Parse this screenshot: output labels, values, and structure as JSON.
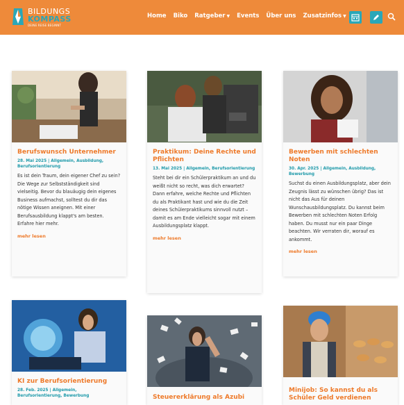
{
  "header": {
    "logo_line1": "BILDUNGS",
    "logo_line2": "KOMPASS",
    "logo_tagline": "DEINE REISE BEGINNT",
    "nav": [
      {
        "label": "Home",
        "dropdown": false
      },
      {
        "label": "Biko",
        "dropdown": false
      },
      {
        "label": "Ratgeber",
        "dropdown": true
      },
      {
        "label": "Events",
        "dropdown": false
      },
      {
        "label": "Über uns",
        "dropdown": false
      },
      {
        "label": "Zusatzinfos",
        "dropdown": true
      }
    ],
    "colors": {
      "bar": "#ee8a3a",
      "accent": "#2aa7b8"
    }
  },
  "cards": [
    {
      "title": "Berufswunsch Unternehmer",
      "meta": "28. Mai 2025 | Allgemein, Ausbildung, Berufsorientierung",
      "excerpt": "Es ist dein Traum, dein eigener Chef zu sein? Die Wege zur Selbstständigkeit sind vielseitig. Bevor du blauäugig dein eigenes Business aufmachst, solltest du dir das nötige Wissen aneignen. Mit einer Berufsausbildung klappt's am besten. Erfahre hier mehr.",
      "more": "mehr lesen"
    },
    {
      "title": "Praktikum: Deine Rechte und Pflichten",
      "meta": "13. Mai 2025 | Allgemein, Berufsorientierung",
      "excerpt": "Steht bei dir ein Schülerpraktikum an und du weißt nicht so recht, was dich erwartet? Dann erfahre, welche Rechte und Pflichten du als Praktikant hast und wie du die Zeit deines Schülerpraktikums sinnvoll nutzt – damit es am Ende vielleicht sogar mit einem Ausbildungsplatz klappt.",
      "more": "mehr lesen"
    },
    {
      "title": "Bewerben mit schlechten Noten",
      "meta": "30. Apr. 2025 | Allgemein, Ausbildung, Bewerbung",
      "excerpt": "Suchst du einen Ausbildungsplatz, aber dein Zeugnis lässt zu wünschen übrig? Das ist nicht das Aus für deinen Wunschausbildungsplatz. Du kannst beim Bewerben mit schlechten Noten Erfolg haben. Du musst nur ein paar Dinge beachten. Wir verraten dir, worauf es ankommt.",
      "more": "mehr lesen"
    },
    {
      "title": "KI zur Berufsorientierung",
      "meta": "28. Feb. 2025 | Allgemein, Berufsorientierung, Bewerbung"
    },
    {
      "title": "Steuererklärung als Azubi"
    },
    {
      "title": "Minijob: So kannst du als Schüler Geld verdienen"
    }
  ]
}
